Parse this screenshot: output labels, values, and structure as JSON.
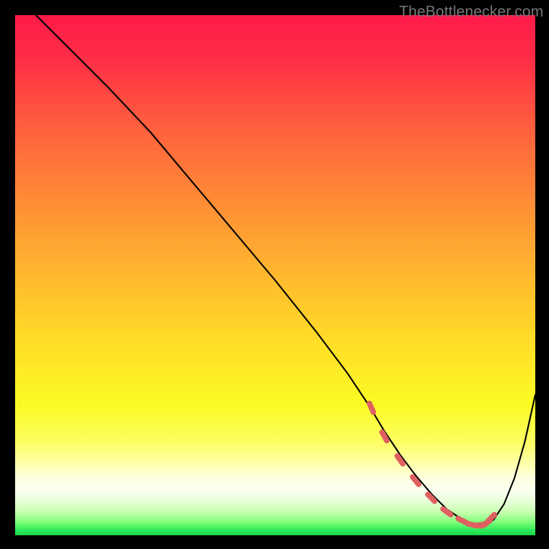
{
  "watermark": "TheBottlenecker.com",
  "gradient_stops": [
    {
      "offset": 0.0,
      "color": "#ff1a49"
    },
    {
      "offset": 0.08,
      "color": "#ff2c46"
    },
    {
      "offset": 0.2,
      "color": "#ff5a3e"
    },
    {
      "offset": 0.35,
      "color": "#ff8a36"
    },
    {
      "offset": 0.5,
      "color": "#ffb82e"
    },
    {
      "offset": 0.65,
      "color": "#ffe326"
    },
    {
      "offset": 0.75,
      "color": "#fbfb24"
    },
    {
      "offset": 0.82,
      "color": "#fdff61"
    },
    {
      "offset": 0.865,
      "color": "#ffffb0"
    },
    {
      "offset": 0.89,
      "color": "#ffffe0"
    },
    {
      "offset": 0.915,
      "color": "#fafff0"
    },
    {
      "offset": 0.935,
      "color": "#e8ffd8"
    },
    {
      "offset": 0.955,
      "color": "#c8ffb0"
    },
    {
      "offset": 0.975,
      "color": "#7dff78"
    },
    {
      "offset": 0.99,
      "color": "#2eeb5a"
    },
    {
      "offset": 1.0,
      "color": "#18d848"
    }
  ],
  "chart_data": {
    "type": "line",
    "title": "",
    "xlabel": "",
    "ylabel": "",
    "xlim": [
      0,
      100
    ],
    "ylim": [
      0,
      100
    ],
    "series": [
      {
        "name": "bottleneck-curve",
        "x": [
          0,
          4,
          8,
          12,
          18,
          26,
          34,
          42,
          50,
          58,
          64,
          68,
          71,
          74,
          77,
          80,
          83,
          86,
          88,
          90,
          92,
          94,
          96,
          98,
          100
        ],
        "y": [
          105,
          100,
          96,
          92,
          86,
          77.5,
          68,
          58.5,
          49,
          39,
          31,
          25,
          20,
          15.5,
          11.5,
          8,
          5,
          3,
          2,
          2,
          3,
          6,
          11,
          18,
          27
        ]
      }
    ],
    "markers": {
      "name": "optimal-range",
      "x": [
        68.5,
        71,
        74,
        77,
        80,
        83,
        86,
        88,
        89.5,
        90.5,
        91.5
      ],
      "y": [
        24.5,
        19,
        14.5,
        10.5,
        7.2,
        4.5,
        2.8,
        2.0,
        2.0,
        2.3,
        3.3
      ]
    }
  }
}
